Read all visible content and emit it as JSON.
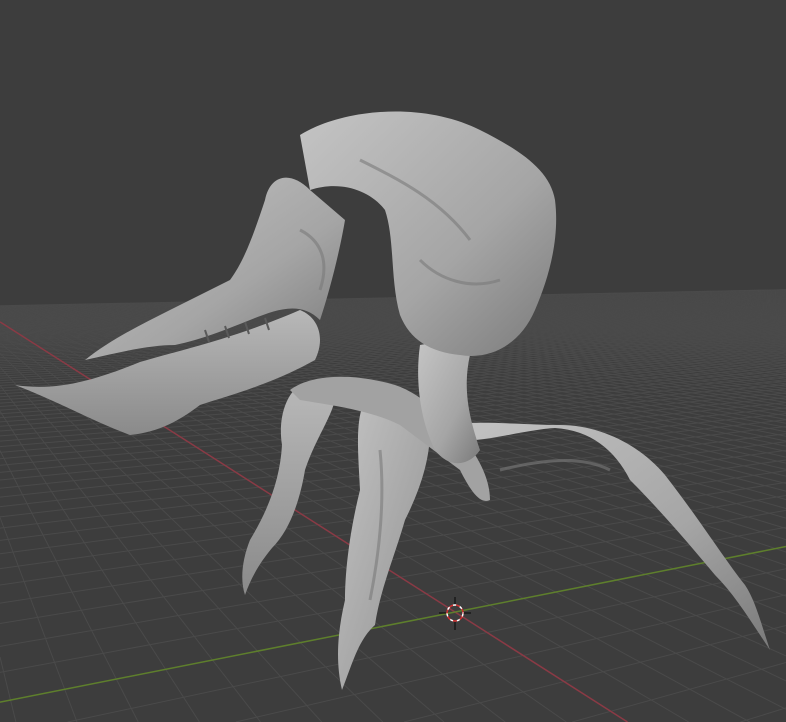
{
  "viewport": {
    "background": "#3d3d3d",
    "grid_color": "#4a4a4a",
    "x_axis_color": "#8a3a45",
    "y_axis_color": "#5e7f2c",
    "model_color": "#a9a9a9",
    "model_shadow": "#6f6f6f"
  },
  "icons": {
    "cursor": "3d-cursor-icon"
  }
}
